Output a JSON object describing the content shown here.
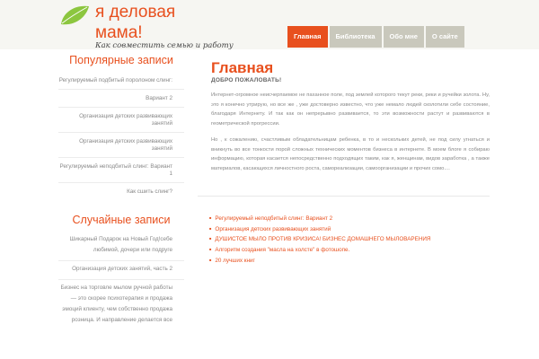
{
  "header": {
    "site_title_line1": "я деловая",
    "site_title_line2": "мама!",
    "tagline": "Как совместить семью и работу",
    "leaf_color": "#8cc63f"
  },
  "nav": {
    "items": [
      {
        "label": "Главная",
        "active": true
      },
      {
        "label": "Библиотека",
        "active": false
      },
      {
        "label": "Обо мне",
        "active": false
      },
      {
        "label": "О сайте",
        "active": false
      }
    ]
  },
  "sidebar": {
    "popular_title": "Популярные записи",
    "popular_items": [
      "Регулируемый подбитый поролоном слинг:",
      "Вариант 2",
      "Организация детских развивающих занятий",
      "Организация детских развивающих занятий",
      "Регулируемый неподбитый слинг: Вариант 1",
      "Как сшить слинг?"
    ],
    "random_title": "Случайные записи",
    "random_items": [
      [
        "Шикарный Подарок на Новый Год!себе",
        "любимой, дочери или подруге"
      ],
      [
        "Организация детских занятий, часть 2"
      ],
      [
        "Бизнес на торговле мылом ручной работы",
        "— это скорее психотерапия и продажа",
        "эмоций клиенту, чем собственно продажа",
        "розница. И направление делается все"
      ]
    ]
  },
  "main": {
    "title": "Главная",
    "welcome": "ДОБРО ПОЖАЛОВАТЬ!",
    "paragraph1": "Интернет-огромное неисчерпаемое не паханное поле, под землей которого текут реки, реки и ручейки золота. Ну, это я конечно утрирую, но все же , уже достоверно известно, что уже немало людей сколотили себе состояние, благодаря Интернету. И так как он непрерывно развивается, то эти возможности растут и развиваются в геометрической прогрессии.",
    "paragraph2": "Но , к сожалению, счастливым обладательницам ребенка, в то и нескольких детей, не под силу угнаться и вникнуть во все тонкости порой сложных технических моментов бизнеса в интернете. В моем блоге я собираю информацию, которая касается непосредственно подходящих таким, как я, женщинам, видов заработка , а также материалов, касающихся личностного роста, самореализации, самоорганизации и прочих сомо...."
  },
  "post_list": [
    "Регулируемый неподбитый слинг: Вариант 2",
    "Организация детских развивающих занятий",
    "ДУШИСТОЕ МЫЛО ПРОТИВ КРИЗИСА! БИЗНЕС ДОМАШНЕГО МЫЛОВАРЕНИЯ",
    "Алгоритм создания \"масла на холсте\" в фотошопе.",
    "20 лучших книг"
  ]
}
